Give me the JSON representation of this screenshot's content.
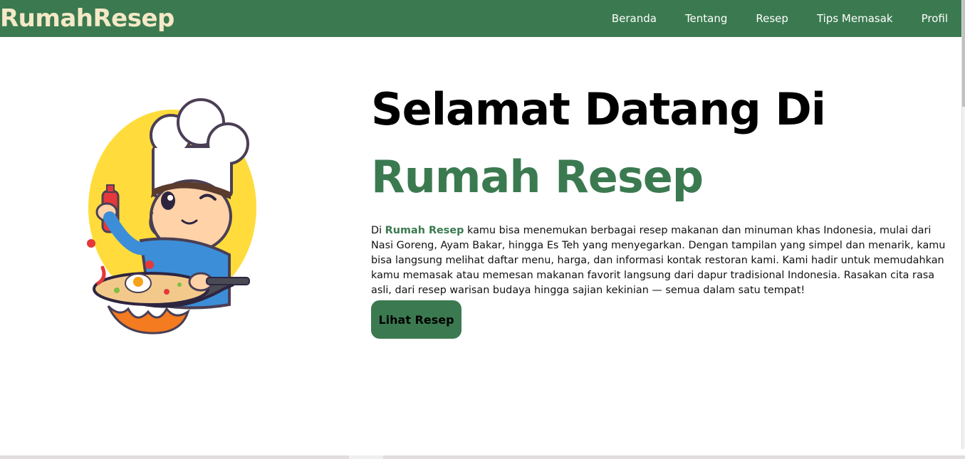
{
  "navbar": {
    "brand": "RumahResep",
    "links": [
      "Beranda",
      "Tentang",
      "Resep",
      "Tips Memasak",
      "Profil"
    ]
  },
  "hero": {
    "title": "Selamat Datang Di",
    "subtitle": "Rumah Resep",
    "description": {
      "prefix": "Di ",
      "brand": "Rumah Resep",
      "text": " kamu bisa menemukan berbagai resep makanan dan minuman khas Indonesia, mulai dari Nasi Goreng, Ayam Bakar, hingga Es Teh yang menyegarkan. Dengan tampilan yang simpel dan menarik, kamu bisa langsung melihat daftar menu, harga, dan informasi kontak restoran kami. Kami hadir untuk memudahkan kamu memasak atau memesan makanan favorit langsung dari dapur tradisional Indonesia. Rasakan cita rasa asli, dari resep warisan budaya hingga sajian kekinian — semua dalam satu tempat!"
    },
    "button_label": "Lihat Resep",
    "image_icon": "chef-cooking-illustration"
  },
  "colors": {
    "primary_green": "#3b7a50",
    "brand_cream": "#f5e9c8",
    "illustration_yellow": "#ffdc3c"
  }
}
